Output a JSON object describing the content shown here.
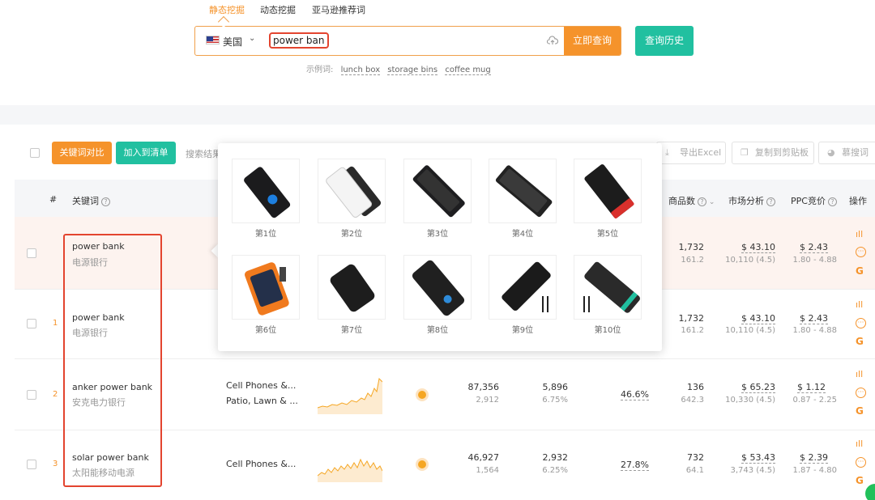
{
  "tabs": [
    {
      "label": "静态挖掘",
      "active": true
    },
    {
      "label": "动态挖掘",
      "active": false
    },
    {
      "label": "亚马逊推荐词",
      "active": false
    }
  ],
  "search": {
    "country": "美国",
    "value": "power bank",
    "button": "立即查询",
    "history_button": "查询历史"
  },
  "examples": {
    "label": "示例词:",
    "items": [
      "lunch box",
      "storage bins",
      "coffee mug"
    ]
  },
  "toolbar": {
    "compare": "关键词对比",
    "add_list": "加入到清单",
    "result_text": "搜索结果",
    "export": "导出Excel",
    "copy": "复制到剪贴板",
    "stats": "慕搜词"
  },
  "headers": {
    "index": "#",
    "keyword": "关键词",
    "products": "商品数",
    "market": "市场分析",
    "ppc": "PPC竞价",
    "action": "操作"
  },
  "rows": [
    {
      "index": "",
      "kw": "power bank",
      "kw_cn": "电源银行",
      "products": "1,732",
      "products_sub": "161.2",
      "market": "$ 43.10",
      "market_sub": "10,110 (4.5)",
      "ppc": "$ 2.43",
      "ppc_sub": "1.80 - 4.88"
    },
    {
      "index": "1",
      "kw": "power bank",
      "kw_cn": "电源银行",
      "products": "1,732",
      "products_sub": "161.2",
      "market": "$ 43.10",
      "market_sub": "10,110 (4.5)",
      "ppc": "$ 2.43",
      "ppc_sub": "1.80 - 4.88"
    },
    {
      "index": "2",
      "kw": "anker power bank",
      "kw_cn": "安克电力银行",
      "cat1": "Cell Phones &...",
      "cat2": "Patio, Lawn & ...",
      "search": "87,356",
      "search_sub": "2,912",
      "purchase": "5,896",
      "purchase_sub": "6.75%",
      "share": "46.6%",
      "products": "136",
      "products_sub": "642.3",
      "market": "$ 65.23",
      "market_sub": "10,330 (4.5)",
      "ppc": "$ 1.12",
      "ppc_sub": "0.87 - 2.25"
    },
    {
      "index": "3",
      "kw": "solar power bank",
      "kw_cn": "太阳能移动电源",
      "cat1": "Cell Phones &...",
      "search": "46,927",
      "search_sub": "1,564",
      "purchase": "2,932",
      "purchase_sub": "6.25%",
      "share": "27.8%",
      "products": "732",
      "products_sub": "64.1",
      "market": "$ 53.43",
      "market_sub": "3,743 (4.5)",
      "ppc": "$ 2.39",
      "ppc_sub": "1.87 - 4.80"
    }
  ],
  "popup": {
    "products": [
      {
        "label": "第1位"
      },
      {
        "label": "第2位"
      },
      {
        "label": "第3位"
      },
      {
        "label": "第4位"
      },
      {
        "label": "第5位"
      },
      {
        "label": "第6位"
      },
      {
        "label": "第7位"
      },
      {
        "label": "第8位"
      },
      {
        "label": "第9位"
      },
      {
        "label": "第10位"
      }
    ]
  },
  "colors": {
    "accent_orange": "#f5932b",
    "accent_green": "#21c0a0",
    "highlight_red": "#e3442f"
  }
}
